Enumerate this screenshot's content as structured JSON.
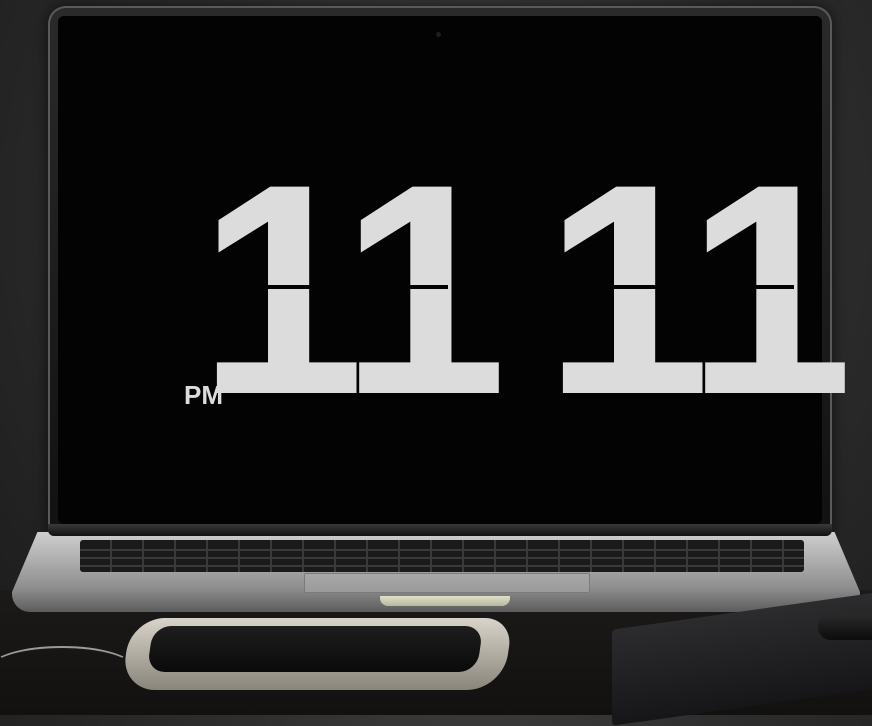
{
  "clock": {
    "hours": "11",
    "minutes": "11",
    "period": "PM"
  },
  "colors": {
    "screen": "#030303",
    "digits": "#dcdcdc",
    "background": "#2e2e2e"
  }
}
